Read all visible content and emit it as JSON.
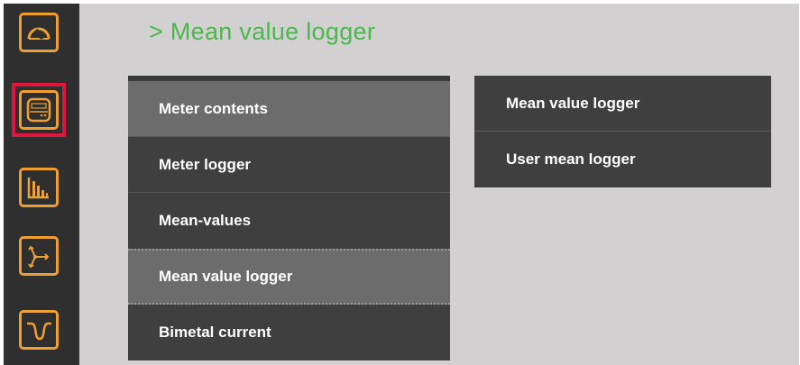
{
  "page": {
    "title": "> Mean value logger"
  },
  "sidebar": {
    "selected_index": 1,
    "items": [
      {
        "icon": "gauge-icon"
      },
      {
        "icon": "meter-icon"
      },
      {
        "icon": "bar-chart-icon"
      },
      {
        "icon": "phasor-icon"
      },
      {
        "icon": "waveform-icon"
      }
    ]
  },
  "menu": {
    "items": [
      {
        "label": "Meter contents",
        "active": true
      },
      {
        "label": "Meter logger",
        "active": false
      },
      {
        "label": "Mean-values",
        "active": false
      },
      {
        "label": "Mean value logger",
        "active": true
      },
      {
        "label": "Bimetal current",
        "active": false
      }
    ]
  },
  "submenu": {
    "items": [
      {
        "label": "Mean value logger"
      },
      {
        "label": "User mean logger"
      }
    ]
  },
  "colors": {
    "accent": "#f0a030",
    "title_green": "#4ab84a",
    "selection_red": "#e0163c",
    "background": "#d2d0d1",
    "panel": "#3f3f3f",
    "highlight": "#6c6c6c"
  }
}
